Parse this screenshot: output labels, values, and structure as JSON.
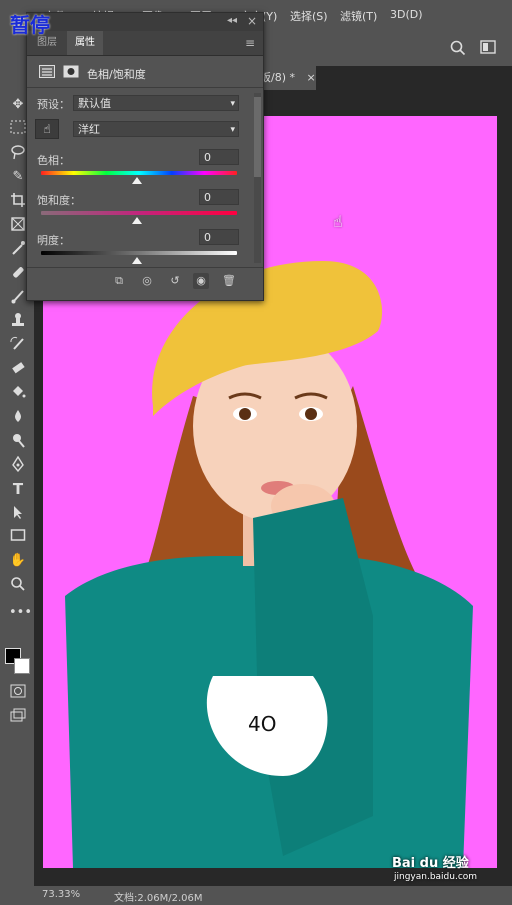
{
  "overlay": {
    "pause": "暂停"
  },
  "menubar": {
    "items": [
      "文件(F)",
      "编辑(E)",
      "图像(I)",
      "图层(L)",
      "文字(Y)",
      "选择(S)",
      "滤镜(T)",
      "3D(D)"
    ]
  },
  "document": {
    "tab_title": "板/8) *",
    "tab_close": "×"
  },
  "panel": {
    "tabs": [
      "图层",
      "属性"
    ],
    "header_title": "色相/饱和度",
    "preset_label": "预设：",
    "preset_value": "默认值",
    "channel_value": "洋红",
    "hue": {
      "label": "色相：",
      "value": "0"
    },
    "saturation": {
      "label": "饱和度：",
      "value": "0"
    },
    "lightness": {
      "label": "明度：",
      "value": "0"
    }
  },
  "statusbar": {
    "zoom": "73.33%",
    "doc": "文档:2.06M/2.06M"
  },
  "watermark": {
    "brand": "Bai du 经验",
    "url": "jingyan.baidu.com"
  },
  "sweater": {
    "text": "4O"
  },
  "colors": {
    "canvas_bg": "#ff66ff",
    "sweater": "#0f8a84",
    "beret": "#f0c23a",
    "pause_text": "#1a2bd8"
  }
}
